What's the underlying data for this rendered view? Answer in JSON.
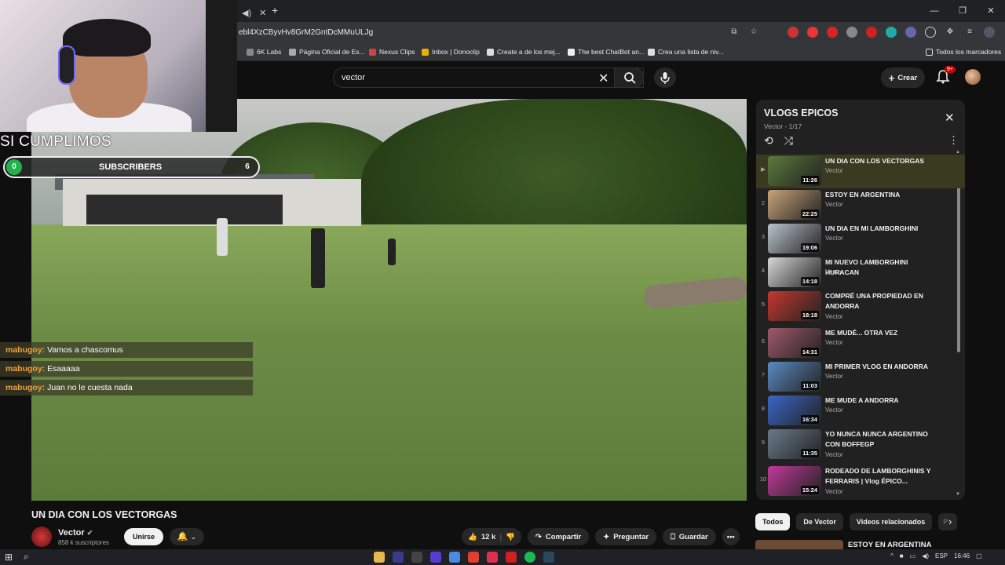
{
  "browser": {
    "url": "ebl4XzCByvHv8GrM2GntDcMMuULJg",
    "new_tab": "+",
    "bookmarks": [
      "6K Labs",
      "Página Oficial de Es...",
      "Nexus Clips",
      "Inbox | Donoclip",
      "Create a de los mej...",
      "The best ChatBot an...",
      "Crea una lista de niv..."
    ],
    "bookmarks_folder": "Todos los marcadores"
  },
  "youtube": {
    "search_value": "vector",
    "create_label": "Crear",
    "notif_badge": "9+"
  },
  "overlay": {
    "caption": "SI CUMPLIMOS",
    "subs_label": "SUBSCRIBERS",
    "subs_left": "0",
    "subs_right": "6",
    "chat": [
      {
        "user": "mabugoy:",
        "msg": "Vamos a chascomus"
      },
      {
        "user": "mabugoy:",
        "msg": "Esaaaaa"
      },
      {
        "user": "mabugoy:",
        "msg": "Juan no le cuesta nada"
      }
    ]
  },
  "video": {
    "title": "UN DIA CON LOS VECTORGAS",
    "channel": "Vector",
    "subscribers": "858 k suscriptores",
    "join_label": "Unirse",
    "likes": "12 k",
    "share_label": "Compartir",
    "ask_label": "Preguntar",
    "save_label": "Guardar"
  },
  "playlist": {
    "title": "VLOGS EPICOS",
    "subtitle": "Vector - 1/17",
    "items": [
      {
        "num": "▶",
        "title": "UN DIA CON LOS VECTORGAS",
        "channel": "Vector",
        "duration": "11:26",
        "color": "#5d7a3c"
      },
      {
        "num": "2",
        "title": "ESTOY EN ARGENTINA",
        "channel": "Vector",
        "duration": "22:25",
        "color": "#c9a37a"
      },
      {
        "num": "3",
        "title": "UN DIA EN MI LAMBORGHINI",
        "channel": "Vector",
        "duration": "19:06",
        "color": "#b9c3cc"
      },
      {
        "num": "4",
        "title": "MI NUEVO LAMBORGHINI HURACAN",
        "channel": "Vector",
        "duration": "14:18",
        "color": "#d8d8d8"
      },
      {
        "num": "5",
        "title": "COMPRÉ UNA PROPIEDAD EN ANDORRA",
        "channel": "Vector",
        "duration": "18:18",
        "color": "#c4382e"
      },
      {
        "num": "6",
        "title": "ME MUDÉ... OTRA VEZ",
        "channel": "Vector",
        "duration": "14:31",
        "color": "#a05a6a"
      },
      {
        "num": "7",
        "title": "MI PRIMER VLOG EN ANDORRA",
        "channel": "Vector",
        "duration": "11:03",
        "color": "#5a8ac2"
      },
      {
        "num": "8",
        "title": "ME MUDE A ANDORRA",
        "channel": "Vector",
        "duration": "16:34",
        "color": "#3a66c8"
      },
      {
        "num": "9",
        "title": "YO NUNCA NUNCA ARGENTINO CON BOFFEGP",
        "channel": "Vector",
        "duration": "11:35",
        "color": "#6a7a8a"
      },
      {
        "num": "10",
        "title": "RODEADO DE LAMBORGHINIS Y FERRARIS | Vlog ÉPICO...",
        "channel": "Vector",
        "duration": "15:24",
        "color": "#c03a9a"
      }
    ]
  },
  "chips": [
    "Todos",
    "De Vector",
    "Videos relacionados",
    "P"
  ],
  "recommended": {
    "title": "ESTOY EN ARGENTINA"
  },
  "taskbar": {
    "lang": "ESP",
    "time": "16:46"
  }
}
